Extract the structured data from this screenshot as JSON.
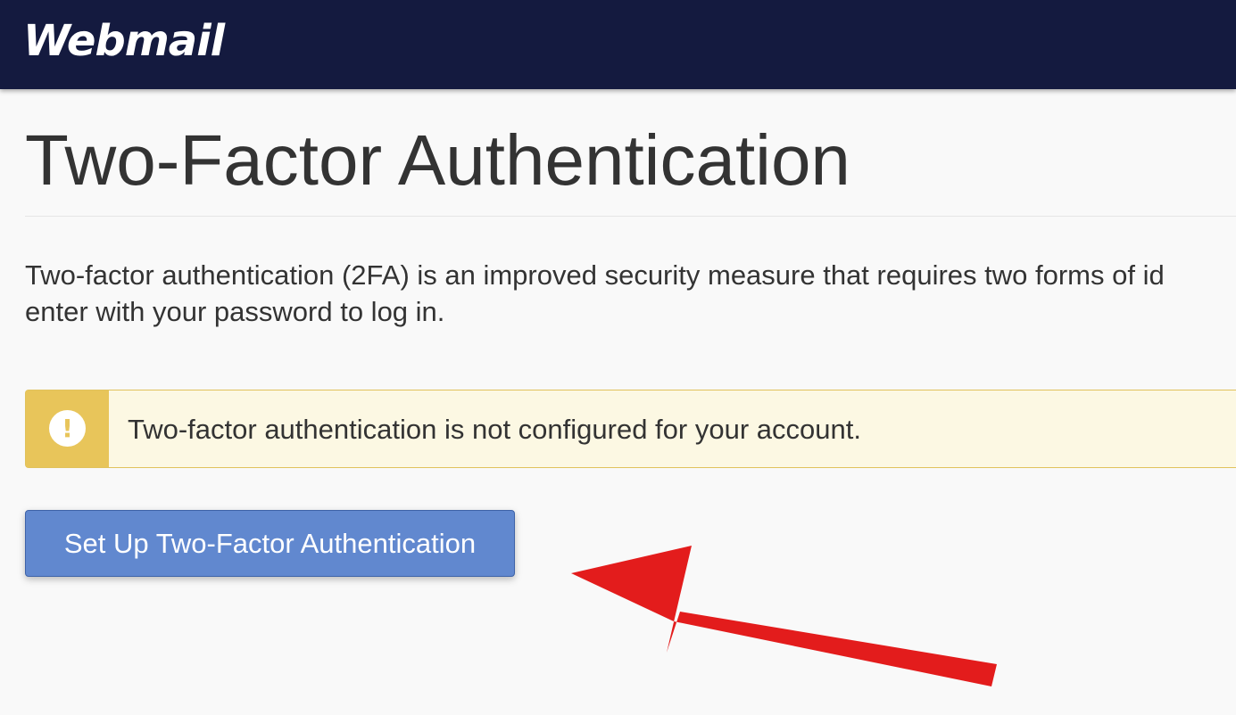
{
  "header": {
    "logo_text": "Webmail",
    "background_color": "#141a3f"
  },
  "main": {
    "title": "Two-Factor Authentication",
    "intro_line1": "Two-factor authentication (2FA) is an improved security measure that requires two forms of id",
    "intro_line2": "enter with your password to log in.",
    "alert": {
      "icon": "exclamation-icon",
      "message": "Two-factor authentication is not configured for your account.",
      "accent_color": "#e8c55a",
      "background_color": "#fcf8e3"
    },
    "setup_button_label": "Set Up Two-Factor Authentication",
    "setup_button_color": "#6188cf"
  },
  "annotation": {
    "icon": "red-arrow-icon",
    "color": "#e31c1c"
  }
}
